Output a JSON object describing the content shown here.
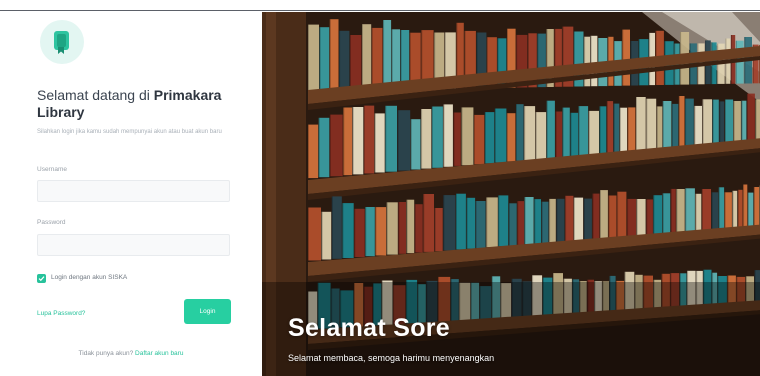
{
  "colors": {
    "accent": "#27c29b",
    "button": "#27cfa1",
    "wood": "#6b3f22",
    "spine_palette": [
      "#1d8a94",
      "#c9b78c",
      "#b5502d",
      "#2c6e7a",
      "#e3d6b4",
      "#8a2f22",
      "#3a9fa5",
      "#d7743d",
      "#f0e6cc",
      "#2a4550",
      "#a33f2a",
      "#5fb6b7"
    ]
  },
  "icons": {
    "logo": "book-logo-icon",
    "checkbox": "checkmark-icon"
  },
  "login": {
    "welcome_prefix": "Selamat datang di",
    "welcome_bold": "Primakara Library",
    "subtitle": "Silahkan login jika kamu sudah mempunyai akun atau buat akun baru",
    "username_label": "Username",
    "password_label": "Password",
    "siska_label": "Login dengan akun SISKA",
    "forgot_label": "Lupa Password?",
    "login_button": "Login",
    "signup_prompt": "Tidak punya akun?",
    "signup_link": "Daftar akun baru"
  },
  "hero": {
    "greeting": "Selamat Sore",
    "message": "Selamat membaca, semoga harimu menyenangkan"
  }
}
